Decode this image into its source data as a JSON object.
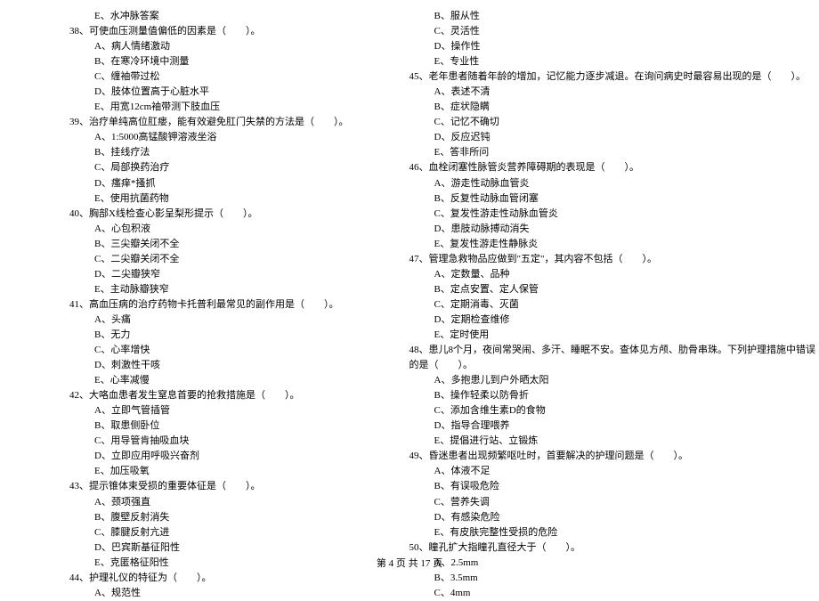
{
  "footer": "第 4 页 共 17 页",
  "left": [
    {
      "cls": "indent1",
      "text": "E、水冲脉答案"
    },
    {
      "cls": "indent-q",
      "text": "38、可使血压测量值偏低的因素是（　　）。"
    },
    {
      "cls": "indent1",
      "text": "A、病人情绪激动"
    },
    {
      "cls": "indent1",
      "text": "B、在寒冷环境中测量"
    },
    {
      "cls": "indent1",
      "text": "C、缠袖带过松"
    },
    {
      "cls": "indent1",
      "text": "D、肢体位置高于心脏水平"
    },
    {
      "cls": "indent1",
      "text": "E、用宽12cm袖带测下肢血压"
    },
    {
      "cls": "indent-q",
      "text": "39、治疗单纯高位肛瘘，能有效避免肛门失禁的方法是（　　）。"
    },
    {
      "cls": "indent1",
      "text": "A、1:5000高锰酸钾溶液坐浴"
    },
    {
      "cls": "indent1",
      "text": "B、挂线疗法"
    },
    {
      "cls": "indent1",
      "text": "C、局部换药治疗"
    },
    {
      "cls": "indent1",
      "text": "D、瘙痒*搔抓"
    },
    {
      "cls": "indent1",
      "text": "E、使用抗菌药物"
    },
    {
      "cls": "indent-q",
      "text": "40、胸部X线检查心影呈梨形提示（　　）。"
    },
    {
      "cls": "indent1",
      "text": "A、心包积液"
    },
    {
      "cls": "indent1",
      "text": "B、三尖瓣关闭不全"
    },
    {
      "cls": "indent1",
      "text": "C、二尖瓣关闭不全"
    },
    {
      "cls": "indent1",
      "text": "D、二尖瓣狭窄"
    },
    {
      "cls": "indent1",
      "text": "E、主动脉瓣狭窄"
    },
    {
      "cls": "indent-q",
      "text": "41、高血压病的治疗药物卡托普利最常见的副作用是（　　）。"
    },
    {
      "cls": "indent1",
      "text": "A、头痛"
    },
    {
      "cls": "indent1",
      "text": "B、无力"
    },
    {
      "cls": "indent1",
      "text": "C、心率增快"
    },
    {
      "cls": "indent1",
      "text": "D、刺激性干咳"
    },
    {
      "cls": "indent1",
      "text": "E、心率减慢"
    },
    {
      "cls": "indent-q",
      "text": "42、大咯血患者发生窒息首要的抢救措施是（　　）。"
    },
    {
      "cls": "indent1",
      "text": "A、立即气管插管"
    },
    {
      "cls": "indent1",
      "text": "B、取患侧卧位"
    },
    {
      "cls": "indent1",
      "text": "C、用导管肯抽吸血块"
    },
    {
      "cls": "indent1",
      "text": "D、立即应用呼吸兴奋剂"
    },
    {
      "cls": "indent1",
      "text": "E、加压吸氧"
    },
    {
      "cls": "indent-q",
      "text": "43、提示锥体束受损的重要体征是（　　）。"
    },
    {
      "cls": "indent1",
      "text": "A、颈项强直"
    },
    {
      "cls": "indent1",
      "text": "B、腹壁反射消失"
    },
    {
      "cls": "indent1",
      "text": "C、膝腱反射亢进"
    },
    {
      "cls": "indent1",
      "text": "D、巴宾斯基征阳性"
    },
    {
      "cls": "indent1",
      "text": "E、克匿格征阳性"
    },
    {
      "cls": "indent-q",
      "text": "44、护理礼仪的特征为（　　）。"
    },
    {
      "cls": "indent1",
      "text": "A、规范性"
    }
  ],
  "right": [
    {
      "cls": "indent1",
      "text": "B、服从性"
    },
    {
      "cls": "indent1",
      "text": "C、灵活性"
    },
    {
      "cls": "indent1",
      "text": "D、操作性"
    },
    {
      "cls": "indent1",
      "text": "E、专业性"
    },
    {
      "cls": "indent-q",
      "text": "45、老年患者随着年龄的增加，记忆能力逐步减退。在询问病史时最容易出现的是（　　）。"
    },
    {
      "cls": "indent1",
      "text": "A、表述不清"
    },
    {
      "cls": "indent1",
      "text": "B、症状隐瞒"
    },
    {
      "cls": "indent1",
      "text": "C、记忆不确切"
    },
    {
      "cls": "indent1",
      "text": "D、反应迟钝"
    },
    {
      "cls": "indent1",
      "text": "E、答非所问"
    },
    {
      "cls": "indent-q",
      "text": "46、血栓闭塞性脉管炎营养障碍期的表现是（　　）。"
    },
    {
      "cls": "indent1",
      "text": "A、游走性动脉血管炎"
    },
    {
      "cls": "indent1",
      "text": "B、反复性动脉血管闭塞"
    },
    {
      "cls": "indent1",
      "text": "C、复发性游走性动脉血管炎"
    },
    {
      "cls": "indent1",
      "text": "D、患肢动脉搏动消失"
    },
    {
      "cls": "indent1",
      "text": "E、复发性游走性静脉炎"
    },
    {
      "cls": "indent-q",
      "text": "47、管理急救物品应做到\"五定\"，其内容不包括（　　）。"
    },
    {
      "cls": "indent1",
      "text": "A、定数量、品种"
    },
    {
      "cls": "indent1",
      "text": "B、定点安置、定人保管"
    },
    {
      "cls": "indent1",
      "text": "C、定期消毒、灭菌"
    },
    {
      "cls": "indent1",
      "text": "D、定期检查维修"
    },
    {
      "cls": "indent1",
      "text": "E、定时使用"
    },
    {
      "cls": "indent-q",
      "text": "48、患儿8个月，夜间常哭闹、多汗、睡眠不安。查体见方颅、肋骨串珠。下列护理措施中错误"
    },
    {
      "cls": "indent-q",
      "text": "的是（　　）。"
    },
    {
      "cls": "indent1",
      "text": "A、多抱患儿到户外晒太阳"
    },
    {
      "cls": "indent1",
      "text": "B、操作轻柔以防骨折"
    },
    {
      "cls": "indent1",
      "text": "C、添加含维生素D的食物"
    },
    {
      "cls": "indent1",
      "text": "D、指导合理喂养"
    },
    {
      "cls": "indent1",
      "text": "E、提倡进行站、立锻炼"
    },
    {
      "cls": "indent-q",
      "text": "49、昏迷患者出现频繁呕吐时，首要解决的护理问题是（　　）。"
    },
    {
      "cls": "indent1",
      "text": "A、体液不足"
    },
    {
      "cls": "indent1",
      "text": "B、有误吸危险"
    },
    {
      "cls": "indent1",
      "text": "C、营养失调"
    },
    {
      "cls": "indent1",
      "text": "D、有感染危险"
    },
    {
      "cls": "indent1",
      "text": "E、有皮肤完整性受损的危险"
    },
    {
      "cls": "indent-q",
      "text": "50、瞳孔扩大指瞳孔直径大于（　　）。"
    },
    {
      "cls": "indent1",
      "text": "A、2.5mm"
    },
    {
      "cls": "indent1",
      "text": "B、3.5mm"
    },
    {
      "cls": "indent1",
      "text": "C、4mm"
    }
  ]
}
